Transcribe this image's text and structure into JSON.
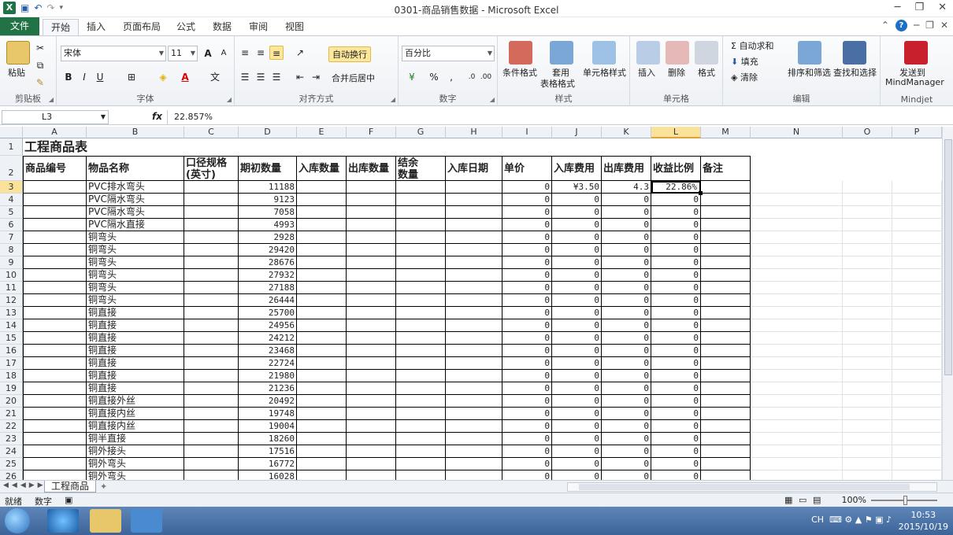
{
  "window": {
    "title": "0301-商品销售数据 - Microsoft Excel",
    "qa_icons": [
      "save-icon",
      "undo-icon",
      "redo-icon"
    ]
  },
  "tabs": [
    {
      "label": "文件"
    },
    {
      "label": "开始"
    },
    {
      "label": "插入"
    },
    {
      "label": "页面布局"
    },
    {
      "label": "公式"
    },
    {
      "label": "数据"
    },
    {
      "label": "审阅"
    },
    {
      "label": "视图"
    }
  ],
  "ribbon": {
    "clipboard": {
      "paste": "粘贴",
      "label": "剪贴板"
    },
    "font": {
      "name": "宋体",
      "size": "11",
      "label": "字体",
      "bold": "B",
      "italic": "I",
      "underline": "U",
      "grow": "A",
      "shrink": "A",
      "phonetic": "文"
    },
    "alignment": {
      "wrap": "自动换行",
      "merge": "合并后居中",
      "label": "对齐方式"
    },
    "number": {
      "format": "百分比",
      "label": "数字",
      "percent": "%",
      "comma": ","
    },
    "styles": {
      "cond": "条件格式",
      "table1": "套用",
      "table2": "表格格式",
      "cellstyle": "单元格样式",
      "label": "样式"
    },
    "cells": {
      "insert": "插入",
      "delete": "删除",
      "format": "格式",
      "label": "单元格"
    },
    "editing": {
      "autosum": "自动求和",
      "fill": "填充",
      "clear": "清除",
      "sort": "排序和筛选",
      "find": "查找和选择",
      "label": "编辑"
    },
    "mindjet": {
      "send1": "发送到",
      "send2": "MindManager",
      "label": "Mindjet"
    }
  },
  "formula_bar": {
    "name_box": "L3",
    "fx": "fx",
    "value": "22.857%"
  },
  "columns": [
    "A",
    "B",
    "C",
    "D",
    "E",
    "F",
    "G",
    "H",
    "I",
    "J",
    "K",
    "L",
    "M",
    "N",
    "O",
    "P"
  ],
  "sheet": {
    "title": "工程商品表",
    "headers": {
      "A": "商品编号",
      "B": "物品名称",
      "C1": "口径规格",
      "C2": "(英寸)",
      "D": "期初数量",
      "E": "入库数量",
      "F": "出库数量",
      "G1": "结余",
      "G2": "数量",
      "H": "入库日期",
      "I": "单价",
      "J": "入库费用",
      "K": "出库费用",
      "L": "收益比例",
      "M": "备注"
    },
    "rows": [
      {
        "n": "3",
        "b": "PVC排水弯头",
        "d": "11188",
        "i": "0",
        "j": "¥3.50",
        "k": "4.3",
        "l": "22.86%"
      },
      {
        "n": "4",
        "b": "PVC隔水弯头",
        "d": "9123",
        "i": "0",
        "j": "0",
        "k": "0",
        "l": "0"
      },
      {
        "n": "5",
        "b": "PVC隔水弯头",
        "d": "7058",
        "i": "0",
        "j": "0",
        "k": "0",
        "l": "0"
      },
      {
        "n": "6",
        "b": "PVC隔水直接",
        "d": "4993",
        "i": "0",
        "j": "0",
        "k": "0",
        "l": "0"
      },
      {
        "n": "7",
        "b": "铜弯头",
        "d": "2928",
        "i": "0",
        "j": "0",
        "k": "0",
        "l": "0"
      },
      {
        "n": "8",
        "b": "铜弯头",
        "d": "29420",
        "i": "0",
        "j": "0",
        "k": "0",
        "l": "0"
      },
      {
        "n": "9",
        "b": "铜弯头",
        "d": "28676",
        "i": "0",
        "j": "0",
        "k": "0",
        "l": "0"
      },
      {
        "n": "10",
        "b": "铜弯头",
        "d": "27932",
        "i": "0",
        "j": "0",
        "k": "0",
        "l": "0"
      },
      {
        "n": "11",
        "b": "铜弯头",
        "d": "27188",
        "i": "0",
        "j": "0",
        "k": "0",
        "l": "0"
      },
      {
        "n": "12",
        "b": "铜弯头",
        "d": "26444",
        "i": "0",
        "j": "0",
        "k": "0",
        "l": "0"
      },
      {
        "n": "13",
        "b": "铜直接",
        "d": "25700",
        "i": "0",
        "j": "0",
        "k": "0",
        "l": "0"
      },
      {
        "n": "14",
        "b": "铜直接",
        "d": "24956",
        "i": "0",
        "j": "0",
        "k": "0",
        "l": "0"
      },
      {
        "n": "15",
        "b": "铜直接",
        "d": "24212",
        "i": "0",
        "j": "0",
        "k": "0",
        "l": "0"
      },
      {
        "n": "16",
        "b": "铜直接",
        "d": "23468",
        "i": "0",
        "j": "0",
        "k": "0",
        "l": "0"
      },
      {
        "n": "17",
        "b": "铜直接",
        "d": "22724",
        "i": "0",
        "j": "0",
        "k": "0",
        "l": "0"
      },
      {
        "n": "18",
        "b": "铜直接",
        "d": "21980",
        "i": "0",
        "j": "0",
        "k": "0",
        "l": "0"
      },
      {
        "n": "19",
        "b": "铜直接",
        "d": "21236",
        "i": "0",
        "j": "0",
        "k": "0",
        "l": "0"
      },
      {
        "n": "20",
        "b": "铜直接外丝",
        "d": "20492",
        "i": "0",
        "j": "0",
        "k": "0",
        "l": "0"
      },
      {
        "n": "21",
        "b": "铜直接内丝",
        "d": "19748",
        "i": "0",
        "j": "0",
        "k": "0",
        "l": "0"
      },
      {
        "n": "22",
        "b": "铜直接内丝",
        "d": "19004",
        "i": "0",
        "j": "0",
        "k": "0",
        "l": "0"
      },
      {
        "n": "23",
        "b": "铜半直接",
        "d": "18260",
        "i": "0",
        "j": "0",
        "k": "0",
        "l": "0"
      },
      {
        "n": "24",
        "b": "铜外接头",
        "d": "17516",
        "i": "0",
        "j": "0",
        "k": "0",
        "l": "0"
      },
      {
        "n": "25",
        "b": "铜外弯头",
        "d": "16772",
        "i": "0",
        "j": "0",
        "k": "0",
        "l": "0"
      },
      {
        "n": "26",
        "b": "铜外弯头",
        "d": "16028",
        "i": "0",
        "j": "0",
        "k": "0",
        "l": "0"
      }
    ]
  },
  "sheet_tab": "工程商品",
  "status": {
    "ready": "就绪",
    "mode": "数字",
    "zoom": "100%"
  },
  "taskbar": {
    "lang": "CH",
    "time": "10:53",
    "date": "2015/10/19"
  },
  "colors": {
    "excel_green": "#217346",
    "selection": "#fbe29a"
  }
}
